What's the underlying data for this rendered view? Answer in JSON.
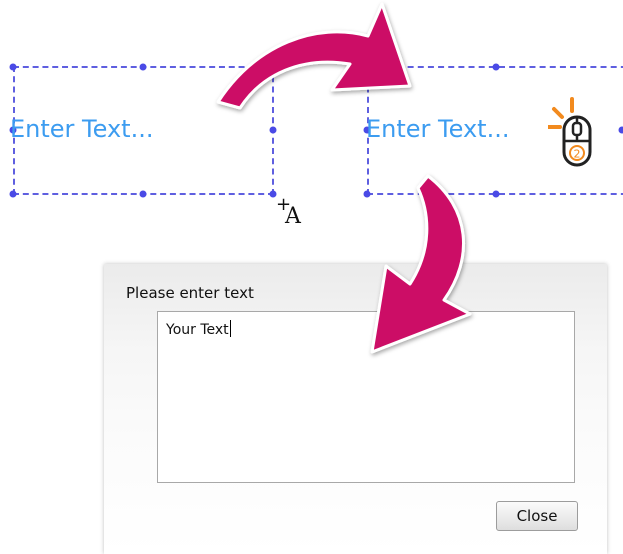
{
  "left_textbox": {
    "placeholder": "Enter Text..."
  },
  "right_textbox": {
    "placeholder": "Enter Text..."
  },
  "cursor": {
    "symbol_plus": "+",
    "symbol_letter": "A"
  },
  "mouse_icon": {
    "click_number": "2",
    "accent_color": "#f28a1e"
  },
  "dialog": {
    "title": "Please enter text",
    "textarea_value": "Your Text",
    "close_label": "Close"
  },
  "colors": {
    "arrow": "#cc1166",
    "dashed_border": "#5f5fe0",
    "placeholder_text": "#3c9cf0"
  }
}
